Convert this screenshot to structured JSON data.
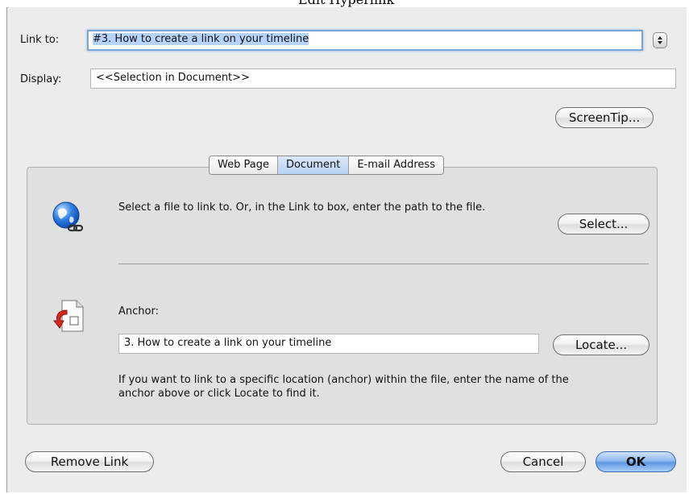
{
  "window": {
    "title": "Edit Hyperlink"
  },
  "link_to": {
    "label": "Link to:",
    "value": "#3. How to create a link on your timeline"
  },
  "display": {
    "label": "Display:",
    "value": "<<Selection in Document>>"
  },
  "screentip_label": "ScreenTip...",
  "tabs": [
    {
      "label": "Web Page",
      "active": false
    },
    {
      "label": "Document",
      "active": true
    },
    {
      "label": "E-mail Address",
      "active": false
    }
  ],
  "select_section": {
    "icon": "globe-link-icon",
    "instruction": "Select a file to link to. Or, in the Link to box, enter the path to the file.",
    "button_label": "Select..."
  },
  "anchor_section": {
    "icon": "document-anchor-icon",
    "label": "Anchor:",
    "value": "3. How to create a link on your timeline",
    "button_label": "Locate...",
    "help_text": "If you want to link to a specific location (anchor) within the file, enter the name of the anchor above or click Locate to find it."
  },
  "footer": {
    "remove_label": "Remove Link",
    "cancel_label": "Cancel",
    "ok_label": "OK"
  },
  "colors": {
    "selection": "#b5d3fb",
    "focus_ring": "#7ba4d7",
    "default_button": "#5f97e3",
    "dialog_background": "#ececec",
    "group_background": "#e0e0e0"
  }
}
